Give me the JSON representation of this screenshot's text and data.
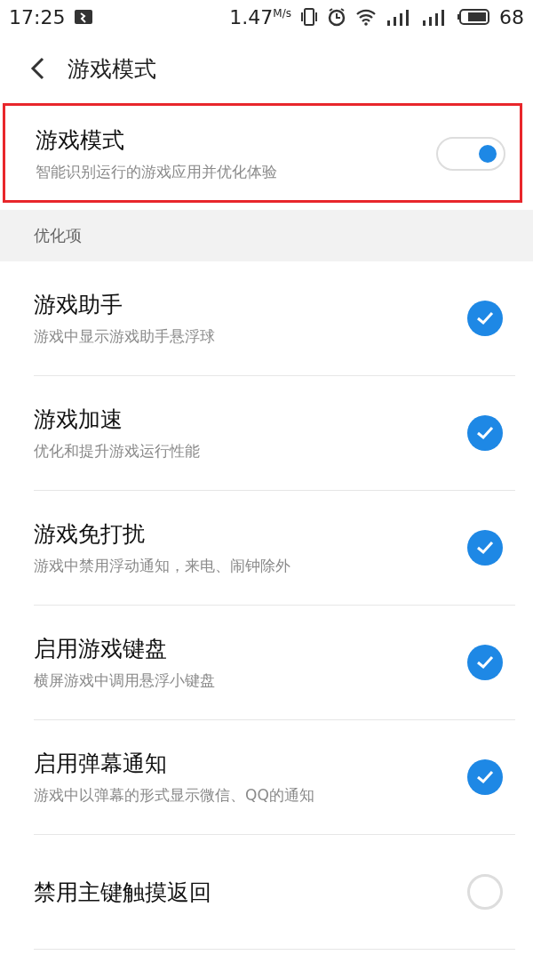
{
  "status_bar": {
    "time": "17:25",
    "speed": "1.47",
    "speed_unit": "M/s",
    "battery": "68"
  },
  "header": {
    "title": "游戏模式"
  },
  "main_setting": {
    "title": "游戏模式",
    "subtitle": "智能识别运行的游戏应用并优化体验",
    "on": true,
    "highlighted": true
  },
  "section": {
    "title": "优化项"
  },
  "options": [
    {
      "title": "游戏助手",
      "subtitle": "游戏中显示游戏助手悬浮球",
      "checked": true
    },
    {
      "title": "游戏加速",
      "subtitle": "优化和提升游戏运行性能",
      "checked": true
    },
    {
      "title": "游戏免打扰",
      "subtitle": "游戏中禁用浮动通知，来电、闹钟除外",
      "checked": true
    },
    {
      "title": "启用游戏键盘",
      "subtitle": "横屏游戏中调用悬浮小键盘",
      "checked": true
    },
    {
      "title": "启用弹幕通知",
      "subtitle": "游戏中以弹幕的形式显示微信、QQ的通知",
      "checked": true
    },
    {
      "title": "禁用主键触摸返回",
      "checked": false
    }
  ]
}
